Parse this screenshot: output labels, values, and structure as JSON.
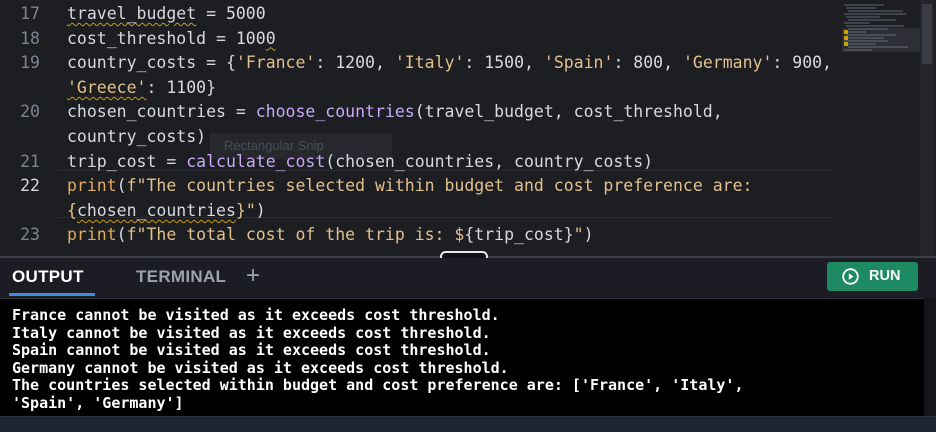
{
  "editor": {
    "ghost_tooltip": "Rectangular Snip",
    "lines": [
      {
        "num": "17",
        "tokens": [
          {
            "t": "travel_budget",
            "c": "squig"
          },
          {
            "t": " = 5000",
            "c": ""
          }
        ]
      },
      {
        "num": "18",
        "tokens": [
          {
            "t": "cost_threshold = 100",
            "c": ""
          },
          {
            "t": "0",
            "c": "squig"
          }
        ]
      },
      {
        "num": "19",
        "tokens": [
          {
            "t": "country_costs = {",
            "c": ""
          },
          {
            "t": "'France'",
            "c": "str"
          },
          {
            "t": ": 1200, ",
            "c": ""
          },
          {
            "t": "'Italy'",
            "c": "str"
          },
          {
            "t": ": 1500, ",
            "c": ""
          },
          {
            "t": "'Spain'",
            "c": "str"
          },
          {
            "t": ": 800, ",
            "c": ""
          },
          {
            "t": "'Germany'",
            "c": "str"
          },
          {
            "t": ": 900,",
            "c": ""
          }
        ]
      },
      {
        "num": "",
        "tokens": [
          {
            "t": "'Greece'",
            "c": "str squig"
          },
          {
            "t": ": 1100}",
            "c": ""
          }
        ]
      },
      {
        "num": "20",
        "tokens": [
          {
            "t": "chosen_countries = ",
            "c": ""
          },
          {
            "t": "choose_countries",
            "c": "fn"
          },
          {
            "t": "(travel_budget, cost_threshold,",
            "c": ""
          }
        ]
      },
      {
        "num": "",
        "tokens": [
          {
            "t": "country_costs)",
            "c": ""
          }
        ]
      },
      {
        "num": "21",
        "tokens": [
          {
            "t": "trip_cost = ",
            "c": ""
          },
          {
            "t": "calculate_cost",
            "c": "fn"
          },
          {
            "t": "(chosen_countries, country_costs)",
            "c": ""
          }
        ]
      },
      {
        "num": "22",
        "active": true,
        "tokens": [
          {
            "t": "print",
            "c": "fnb"
          },
          {
            "t": "(",
            "c": ""
          },
          {
            "t": "f\"The countries selected within budget and cost preference are:",
            "c": "str"
          }
        ]
      },
      {
        "num": "",
        "tokens": [
          {
            "t": "{",
            "c": "str"
          },
          {
            "t": "chosen_countries",
            "c": "squig"
          },
          {
            "t": "}\"",
            "c": "str"
          },
          {
            "t": ")",
            "c": ""
          }
        ]
      },
      {
        "num": "23",
        "tokens": [
          {
            "t": "print",
            "c": "fnb"
          },
          {
            "t": "(",
            "c": ""
          },
          {
            "t": "f\"The total cost of the trip is: $",
            "c": "str"
          },
          {
            "t": "{trip_cost}",
            "c": ""
          },
          {
            "t": "\"",
            "c": "str"
          },
          {
            "t": ")",
            "c": ""
          }
        ]
      }
    ]
  },
  "panel": {
    "tabs": [
      {
        "label": "OUTPUT",
        "active": true
      },
      {
        "label": "TERMINAL",
        "active": false
      }
    ],
    "add_label": "+",
    "run_label": "RUN",
    "output_lines": [
      "France cannot be visited as it exceeds cost threshold.",
      "Italy cannot be visited as it exceeds cost threshold.",
      "Spain cannot be visited as it exceeds cost threshold.",
      "Germany cannot be visited as it exceeds cost threshold.",
      "The countries selected within budget and cost preference are: ['France', 'Italy',",
      "'Spain', 'Germany']"
    ]
  },
  "colors": {
    "run_button": "#1e8a63",
    "active_tab_underline": "#3d8be6",
    "string": "#e2c08d",
    "function": "#c9a8fa",
    "builtin": "#e0a95f"
  }
}
